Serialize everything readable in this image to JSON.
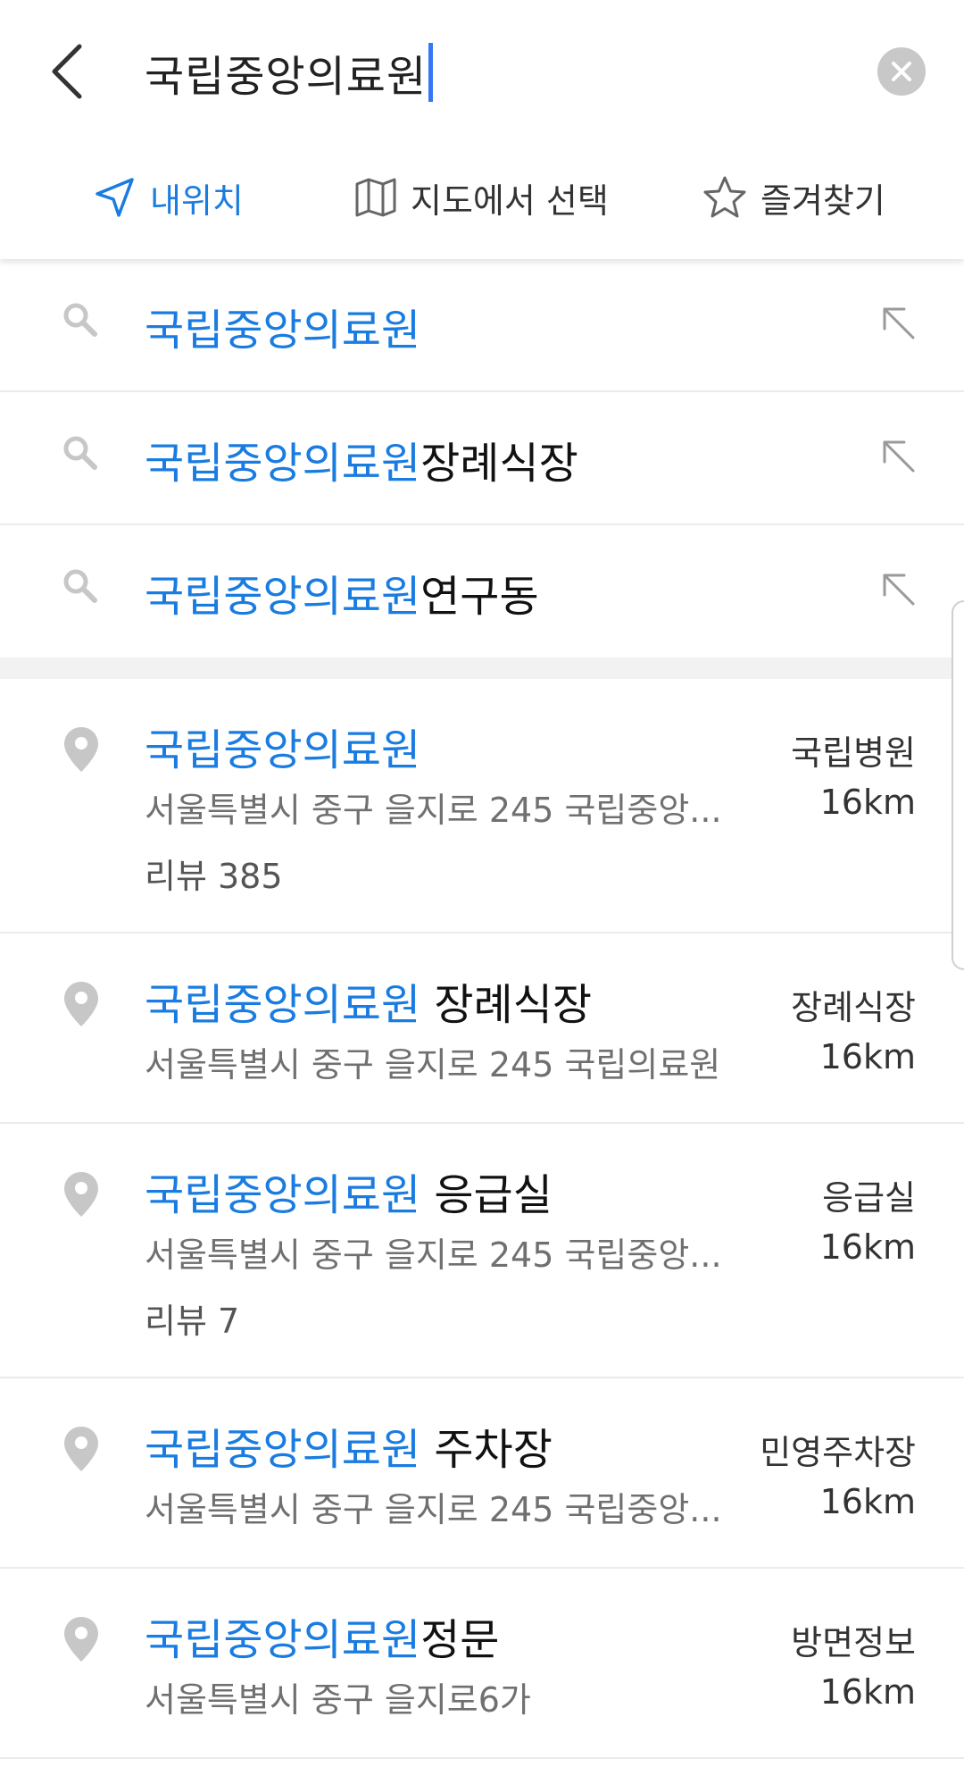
{
  "search": {
    "query": "국립중앙의료원"
  },
  "filters": [
    {
      "label": "내위치",
      "icon": "location-arrow-icon",
      "active": true
    },
    {
      "label": "지도에서 선택",
      "icon": "map-icon",
      "active": false
    },
    {
      "label": "즐겨찾기",
      "icon": "star-icon",
      "active": false
    }
  ],
  "suggestions": [
    {
      "highlight": "국립중앙의료원",
      "rest": ""
    },
    {
      "highlight": "국립중앙의료원",
      "rest": "장례식장"
    },
    {
      "highlight": "국립중앙의료원",
      "rest": "연구동"
    }
  ],
  "results": [
    {
      "highlight": "국립중앙의료원",
      "rest": "",
      "category": "국립병원",
      "address": "서울특별시 중구 을지로 245 국립중앙...",
      "distance": "16km",
      "review": "리뷰 385"
    },
    {
      "highlight": "국립중앙의료원",
      "rest": " 장례식장",
      "category": "장례식장",
      "address": "서울특별시 중구 을지로 245 국립의료원",
      "distance": "16km",
      "review": ""
    },
    {
      "highlight": "국립중앙의료원",
      "rest": " 응급실",
      "category": "응급실",
      "address": "서울특별시 중구 을지로 245 국립중앙...",
      "distance": "16km",
      "review": "리뷰 7"
    },
    {
      "highlight": "국립중앙의료원",
      "rest": " 주차장",
      "category": "민영주차장",
      "address": "서울특별시 중구 을지로 245 국립중앙...",
      "distance": "16km",
      "review": ""
    },
    {
      "highlight": "국립중앙의료원",
      "rest": "정문",
      "category": "방면정보",
      "address": "서울특별시 중구 을지로6가",
      "distance": "16km",
      "review": ""
    }
  ],
  "colors": {
    "accent": "#1a7ce0",
    "caret": "#3478f6",
    "icon_gray": "#c7c7c7"
  }
}
